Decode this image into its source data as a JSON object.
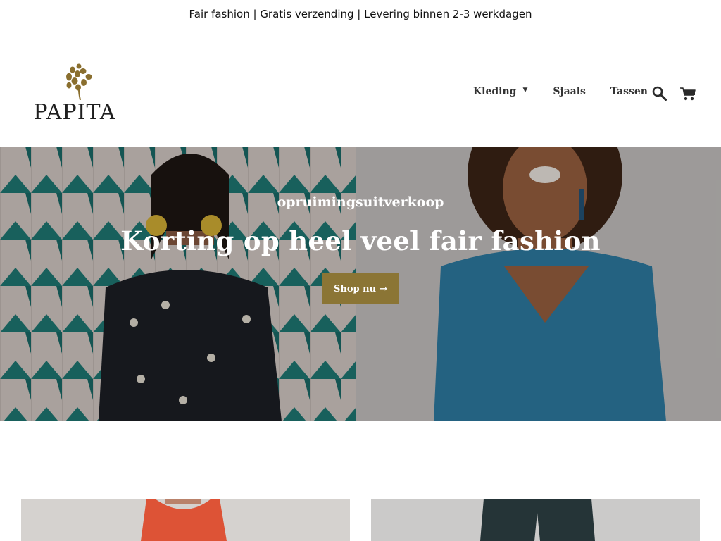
{
  "announcement": {
    "text": "Fair fashion | Gratis verzending | Levering binnen 2-3 werkdagen"
  },
  "header": {
    "logo_text": "PAPITA",
    "nav": {
      "kleding": "Kleding",
      "sjaals": "Sjaals",
      "tassen": "Tassen"
    },
    "caret_icon": "caret-down-icon",
    "search_icon": "search-icon",
    "cart_icon": "cart-icon"
  },
  "hero": {
    "subtitle": "opruimingsuitverkoop",
    "title": "Korting op heel veel fair fashion",
    "button_label": "Shop nu",
    "button_arrow": "→"
  },
  "colors": {
    "accent": "#8b7535",
    "logo_leaf": "#8a6f2f",
    "text": "#1d1d1d"
  }
}
